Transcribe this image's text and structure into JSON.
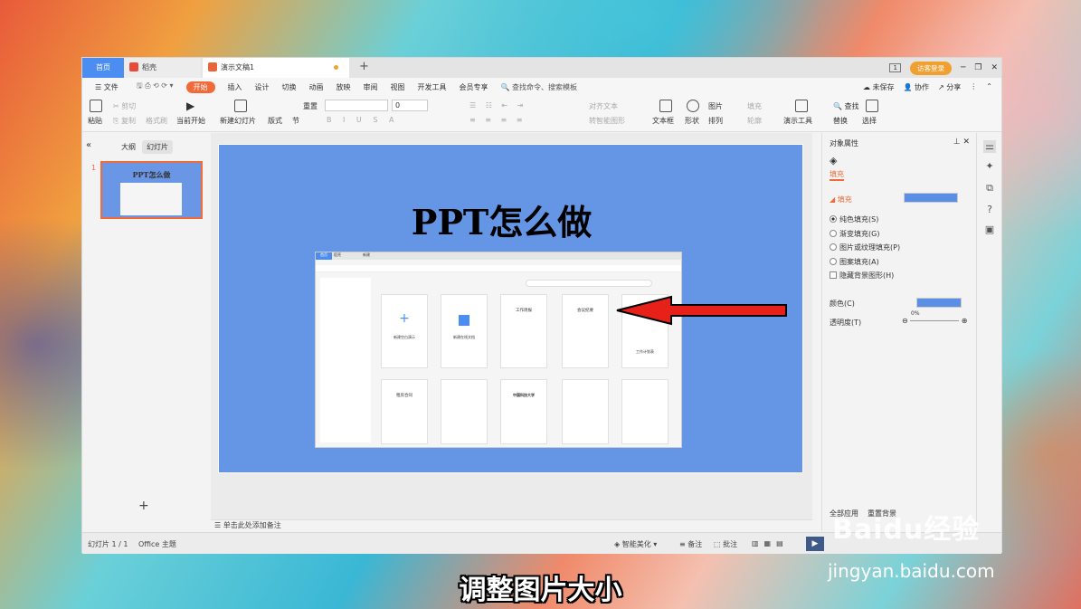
{
  "tabs": {
    "home": "首页",
    "daoke": "稻壳",
    "doc": "演示文稿1",
    "new_tab": "+"
  },
  "window": {
    "login": "访客登录",
    "page_indicator": "1"
  },
  "menu": {
    "file": "文件",
    "items": [
      "开始",
      "插入",
      "设计",
      "切换",
      "动画",
      "放映",
      "审阅",
      "视图",
      "开发工具",
      "会员专享"
    ],
    "search": "查找命令、搜索模板",
    "unsaved": "未保存",
    "collab": "协作",
    "share": "分享"
  },
  "ribbon": {
    "paste": "粘贴",
    "cut": "剪切",
    "copy": "复制",
    "format_painter": "格式刷",
    "from_start": "当前开始",
    "new_slide": "新建幻灯片",
    "layout": "版式",
    "section": "节",
    "reset": "重置",
    "font_size": "0",
    "align_text": "对齐文本",
    "smart_shape": "转智能图形",
    "text_box": "文本框",
    "shape": "形状",
    "arrange": "排列",
    "picture": "图片",
    "fill": "填充",
    "outline": "轮廓",
    "present_tools": "演示工具",
    "find": "查找",
    "replace": "替换",
    "select": "选择"
  },
  "left_pane": {
    "outline_tab": "大纲",
    "slides_tab": "幻灯片",
    "slide_number": "1",
    "thumb_title": "PPT怎么做"
  },
  "slide": {
    "title": "PPT怎么做"
  },
  "inner_shot": {
    "tab1": "首页",
    "tab2": "稻壳",
    "tab3": "新建",
    "cards_row1": [
      "新建空白演示",
      "新建在线文档",
      "工作周报",
      "会议纪要",
      "工作计划表"
    ],
    "cards_row2": [
      "租房合同",
      "",
      "中国科技大学",
      "",
      ""
    ]
  },
  "notes": {
    "placeholder": "单击此处添加备注"
  },
  "props": {
    "title": "对象属性",
    "tab": "填充",
    "section": "填充",
    "options": [
      "纯色填充(S)",
      "渐变填充(G)",
      "图片或纹理填充(P)",
      "图案填充(A)"
    ],
    "hide_bg": "隐藏背景图形(H)",
    "color_label": "颜色(C)",
    "transparency_label": "透明度(T)",
    "transparency_value": "0%",
    "apply_all": "全部应用",
    "reset_bg": "重置背景",
    "fill_color": "#5b8fe6"
  },
  "status": {
    "slide_count": "幻灯片 1 / 1",
    "theme": "Office 主题",
    "beautify": "智能美化",
    "notes": "备注",
    "comment": "批注"
  },
  "caption": "调整图片大小",
  "watermark": {
    "brand": "Baidu经验",
    "url": "jingyan.baidu.com"
  }
}
